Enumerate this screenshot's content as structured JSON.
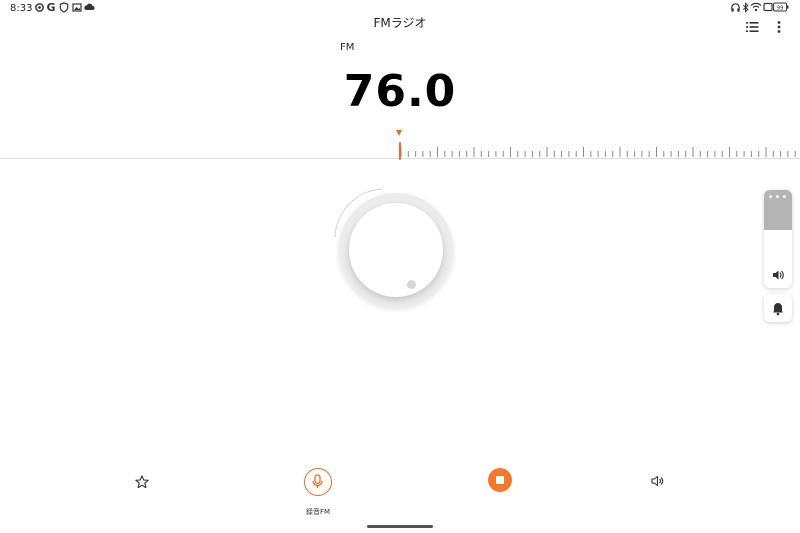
{
  "status_bar": {
    "time": "8:33",
    "left_icons": [
      "settings-icon",
      "google-g-icon",
      "shield-icon",
      "gallery-icon",
      "cloud-icon"
    ],
    "right_icons": [
      "headphones-icon",
      "bluetooth-icon",
      "wifi-icon",
      "tablet-icon",
      "battery-icon"
    ],
    "battery_level": "99"
  },
  "app": {
    "title": "FMラジオ"
  },
  "tuner": {
    "band": "FM",
    "frequency": "76.0",
    "accent_color": "#f06a23"
  },
  "bottom_bar": {
    "record_label": "録音FM"
  },
  "side_panel": {
    "handle_dots": "•••"
  }
}
